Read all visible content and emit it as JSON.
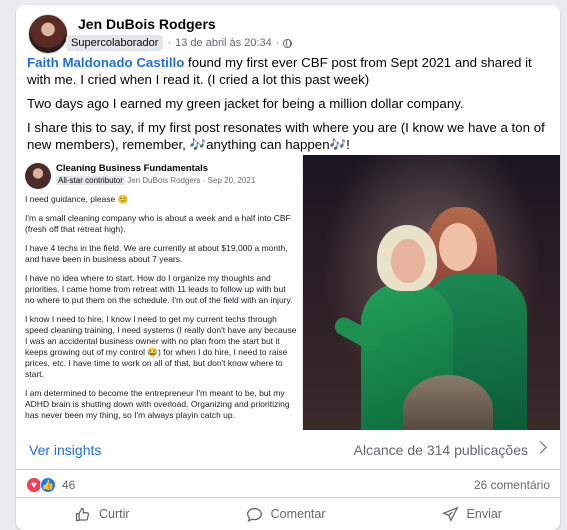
{
  "post": {
    "author": "Jen DuBois Rodgers",
    "badge": "Supercolaborador",
    "timestamp": "13 de abril às 20:34",
    "visibility_icon": "globe-icon",
    "mention": "Faith Maldonado Castillo",
    "line1_rest": " found my first ever CBF post from Sept 2021 and shared it with me. I cried when I read it. (I cried a lot this past week)",
    "line2": "Two days ago I earned my green jacket for being a million dollar company.",
    "line3": "I share this to say, if my first post resonates with where you are (I know we have a ton of new members), remember, 🎶anything can happen🎶!"
  },
  "embedded_post": {
    "group": "Cleaning Business Fundamentals",
    "badge": "All-star contributor",
    "author": "Jen DuBois Rodgers",
    "date": "Sep 20, 2021",
    "paragraphs": [
      "I need guidance, please 😊",
      "I'm a small cleaning company who is about a week and a half into CBF (fresh off that retreat high).",
      "I have 4 techs in the field. We are currently at about $19,000 a month, and have been in business about 7 years.",
      "I have no idea where to start. How do I organize my thoughts and priorities. I came home from retreat with 11 leads to follow up with but no where to put them on the schedule. I'm out of the field with an injury.",
      "I know I need to hire, I know I need to get my current techs through speed cleaning training, I need systems (I really don't have any because I was an accidental business owner with no plan from the start but it keeps growing out of my control 😂) for when I do hire, I need to raise prices, etc. I have time to work on all of that, but don't know where to start.",
      "I am determined to become the entrepreneur I'm meant to be, but my ADHD brain is shutting down with overload. Organizing and prioritizing has never been my thing, so I'm always playin catch up."
    ]
  },
  "insights": {
    "link": "Ver insights",
    "reach": "Alcance de 314 publicações"
  },
  "stats": {
    "reactions_count": "46",
    "comments": "26 comentário"
  },
  "actions": {
    "like": "Curtir",
    "comment": "Comentar",
    "share": "Enviar"
  },
  "colors": {
    "link": "#216fdb",
    "muted": "#65676b",
    "heart": "#f33e58",
    "like": "#1877f2"
  }
}
